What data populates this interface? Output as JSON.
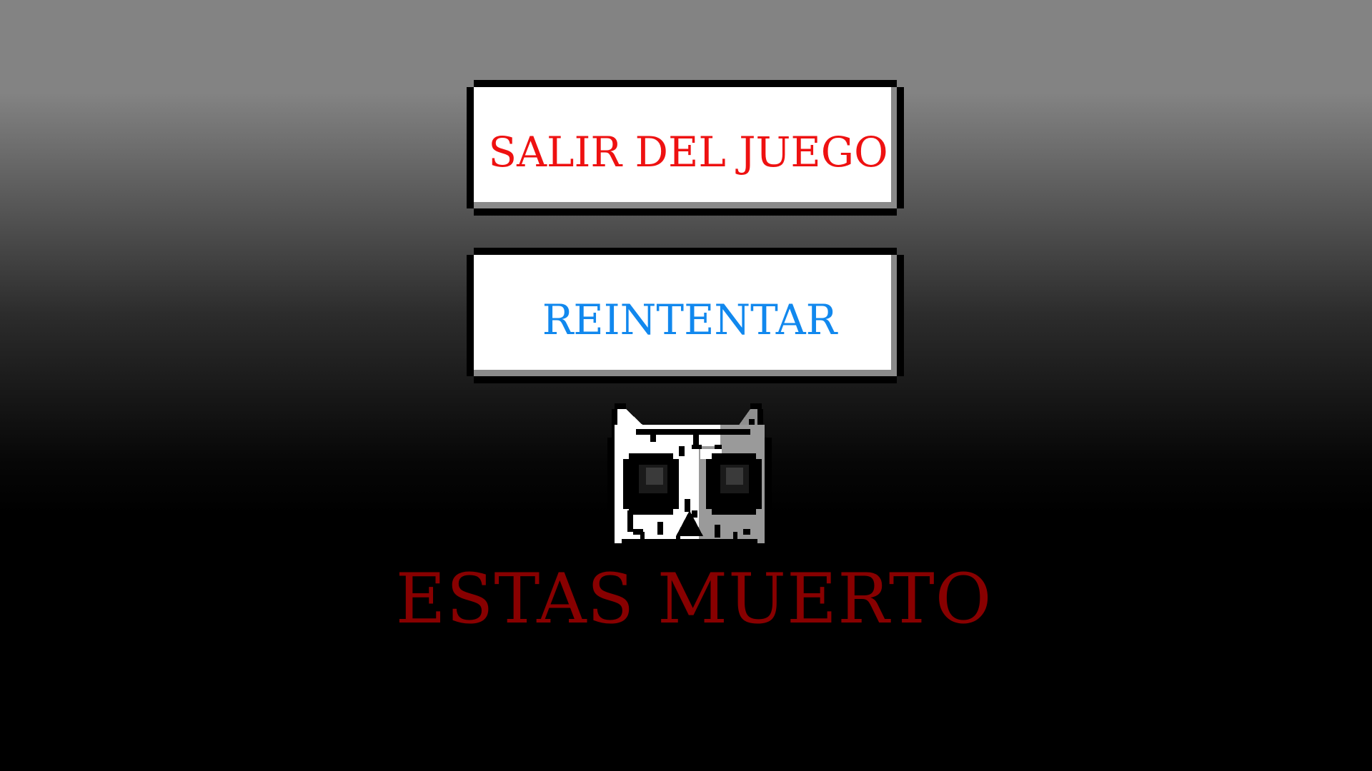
{
  "menu": {
    "quit_label": "SALIR DEL JUEGO",
    "retry_label": "REINTENTAR"
  },
  "game_over": {
    "title": "ESTAS MUERTO",
    "icon": "skull-icon"
  },
  "colors": {
    "quit_text": "#ee1111",
    "retry_text": "#1188ee",
    "title_text": "#880000",
    "button_fill": "#ffffff",
    "button_border": "#000000",
    "button_shadow": "#8a8a8a",
    "background_top": "#838383",
    "background_bottom": "#000000"
  }
}
